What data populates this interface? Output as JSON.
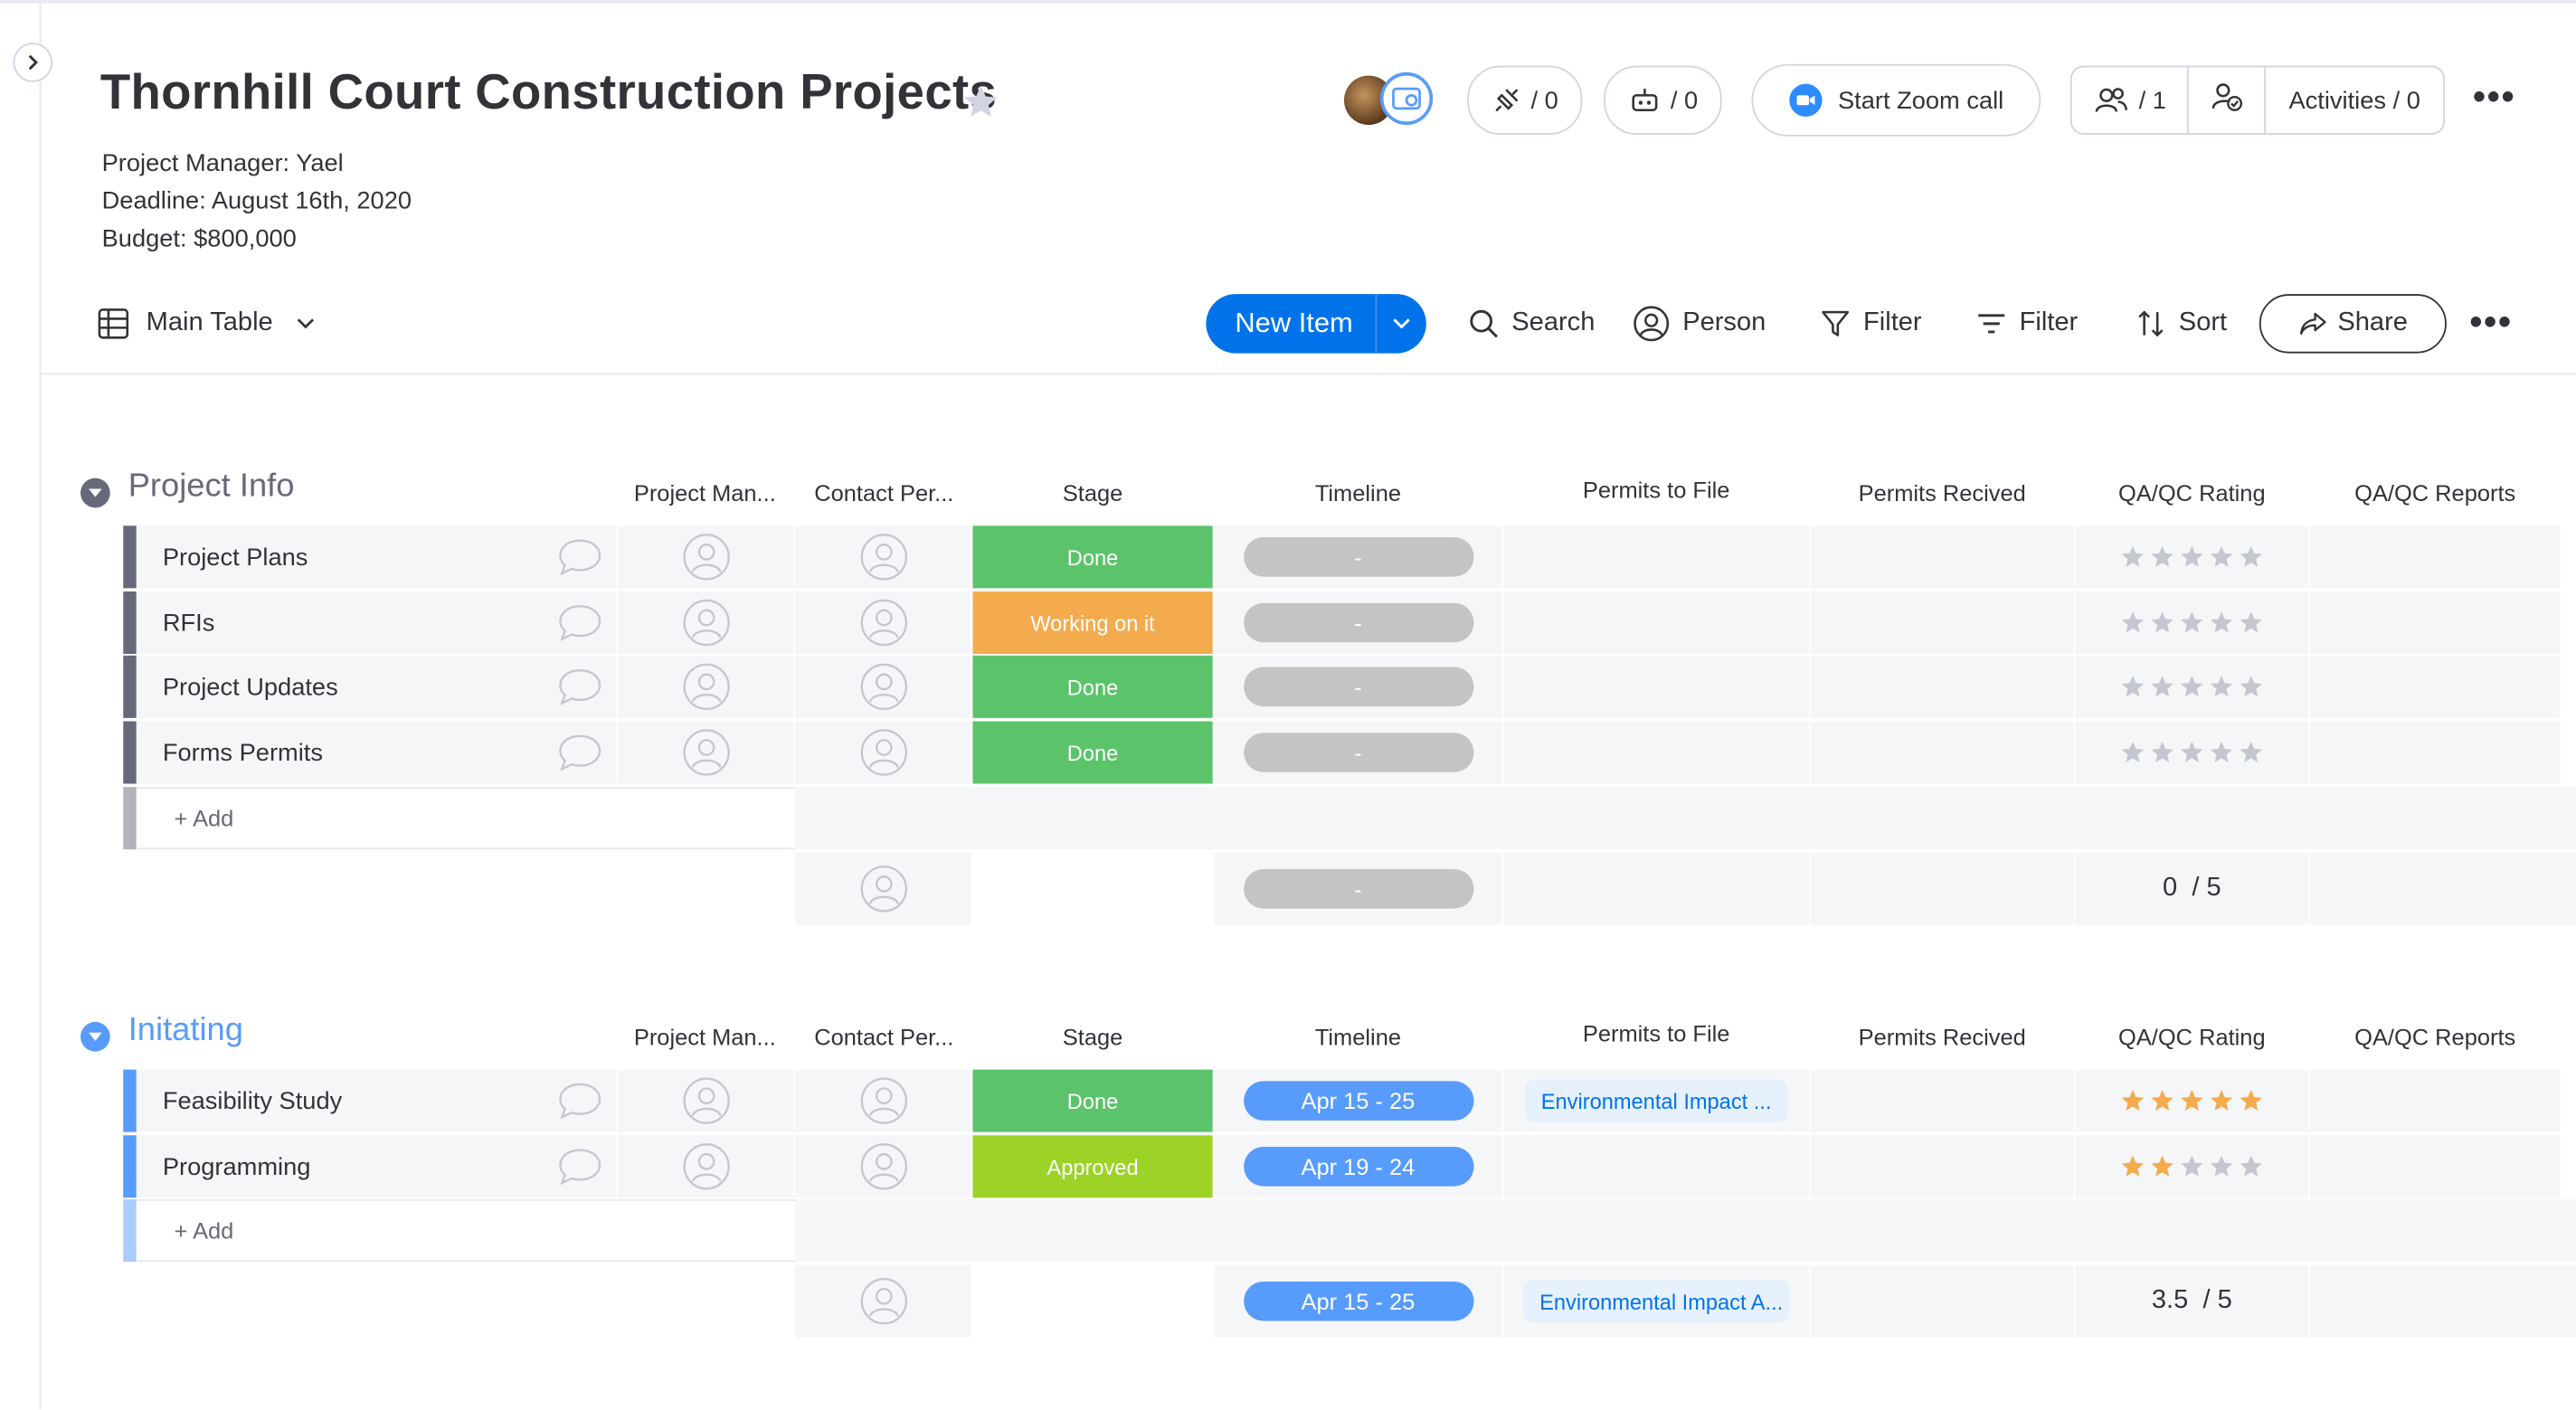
{
  "board": {
    "title": "Thornhill Court Construction Projects",
    "description": [
      "Project Manager: Yael",
      "Deadline: August 16th, 2020",
      "Budget: $800,000"
    ]
  },
  "header": {
    "integrations_count": "/ 0",
    "automations_count": "/ 0",
    "zoom_label": "Start Zoom call",
    "members_count": "/ 1",
    "activities_label": "Activities / 0"
  },
  "toolbar": {
    "view_label": "Main Table",
    "new_item_label": "New Item",
    "search_label": "Search",
    "person_label": "Person",
    "filter_label": "Filter",
    "filter2_label": "Filter",
    "sort_label": "Sort",
    "share_label": "Share"
  },
  "columns": [
    "Project Man...",
    "Contact Per...",
    "Stage",
    "Timeline",
    "Permits to File",
    "Permits Recived",
    "QA/QC Rating",
    "QA/QC Reports"
  ],
  "groups": [
    {
      "title": "Project Info",
      "color": "#676879",
      "add_label": "+ Add",
      "items": [
        {
          "name": "Project Plans",
          "stage": "Done",
          "stage_color": "#5bc46a",
          "timeline": "-",
          "permits": "",
          "rating": 0
        },
        {
          "name": "RFIs",
          "stage": "Working on it",
          "stage_color": "#f4ab4e",
          "timeline": "-",
          "permits": "",
          "rating": 0
        },
        {
          "name": "Project Updates",
          "stage": "Done",
          "stage_color": "#5bc46a",
          "timeline": "-",
          "permits": "",
          "rating": 0
        },
        {
          "name": "Forms Permits",
          "stage": "Done",
          "stage_color": "#5bc46a",
          "timeline": "-",
          "permits": "",
          "rating": 0
        }
      ],
      "summary": {
        "timeline": "-",
        "permits": "",
        "rating": "0  / 5"
      }
    },
    {
      "title": "Initating",
      "color": "#579bfc",
      "add_label": "+ Add",
      "items": [
        {
          "name": "Feasibility Study",
          "stage": "Done",
          "stage_color": "#5bc46a",
          "timeline": "Apr 15 - 25",
          "permits": "Environmental Impact ...",
          "rating": 5
        },
        {
          "name": "Programming",
          "stage": "Approved",
          "stage_color": "#9cd326",
          "timeline": "Apr 19 - 24",
          "permits": "",
          "rating": 2
        }
      ],
      "summary": {
        "timeline": "Apr 15 - 25",
        "permits": "Environmental Impact A...",
        "rating": "3.5  / 5"
      }
    }
  ],
  "colors": {
    "primary": "#0073ea",
    "timeline_empty": "#c4c4c4",
    "timeline_active": "#579bfc",
    "star_on": "#f4ab4e",
    "star_off": "#c5c7d0"
  }
}
